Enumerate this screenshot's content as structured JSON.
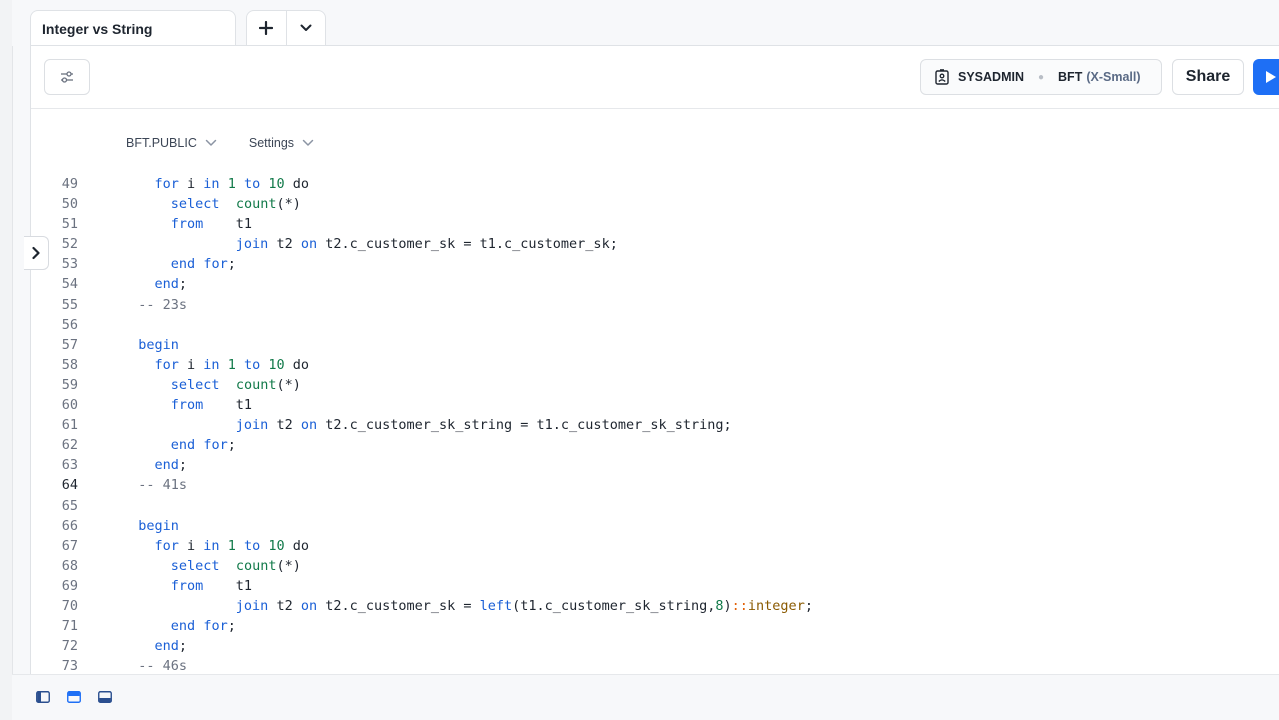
{
  "tabs": {
    "active_title": "Integer vs String"
  },
  "icons": {
    "add": "plus-icon",
    "menu": "chevron-down-icon",
    "filter": "filter-sliders-icon",
    "role": "id-badge-icon",
    "run": "play-icon",
    "rail": "chevron-right-icon"
  },
  "context": {
    "role": "SYSADMIN",
    "warehouse": "BFT",
    "warehouse_size": "(X-Small)"
  },
  "toolbar": {
    "share_label": "Share"
  },
  "db_context": {
    "database": "BFT.PUBLIC",
    "settings": "Settings"
  },
  "colors": {
    "accent": "#1e6ff5",
    "keyword": "#1a5fd6",
    "function": "#127a4a"
  },
  "code": {
    "active_line": 64,
    "lines": [
      {
        "n": 49,
        "indent": 4,
        "tokens": [
          [
            "kw",
            "for"
          ],
          [
            "t",
            " i "
          ],
          [
            "kw",
            "in"
          ],
          [
            "t",
            " "
          ],
          [
            "num",
            "1"
          ],
          [
            "t",
            " "
          ],
          [
            "kw",
            "to"
          ],
          [
            "t",
            " "
          ],
          [
            "num",
            "10"
          ],
          [
            "t",
            " do"
          ]
        ]
      },
      {
        "n": 50,
        "indent": 6,
        "tokens": [
          [
            "kw",
            "select"
          ],
          [
            "t",
            "  "
          ],
          [
            "fn",
            "count"
          ],
          [
            "t",
            "(*)"
          ]
        ]
      },
      {
        "n": 51,
        "indent": 6,
        "tokens": [
          [
            "kw",
            "from"
          ],
          [
            "t",
            "    t1"
          ]
        ]
      },
      {
        "n": 52,
        "indent": 14,
        "tokens": [
          [
            "kw",
            "join"
          ],
          [
            "t",
            " t2 "
          ],
          [
            "kw",
            "on"
          ],
          [
            "t",
            " t2.c_customer_sk = t1.c_customer_sk;"
          ]
        ]
      },
      {
        "n": 53,
        "indent": 6,
        "tokens": [
          [
            "kw",
            "end"
          ],
          [
            "t",
            " "
          ],
          [
            "kw",
            "for"
          ],
          [
            "t",
            ";"
          ]
        ]
      },
      {
        "n": 54,
        "indent": 4,
        "tokens": [
          [
            "kw",
            "end"
          ],
          [
            "t",
            ";"
          ]
        ]
      },
      {
        "n": 55,
        "indent": 2,
        "tokens": [
          [
            "cm",
            "-- 23s"
          ]
        ]
      },
      {
        "n": 56,
        "indent": 0,
        "tokens": []
      },
      {
        "n": 57,
        "indent": 2,
        "tokens": [
          [
            "kw",
            "begin"
          ]
        ]
      },
      {
        "n": 58,
        "indent": 4,
        "tokens": [
          [
            "kw",
            "for"
          ],
          [
            "t",
            " i "
          ],
          [
            "kw",
            "in"
          ],
          [
            "t",
            " "
          ],
          [
            "num",
            "1"
          ],
          [
            "t",
            " "
          ],
          [
            "kw",
            "to"
          ],
          [
            "t",
            " "
          ],
          [
            "num",
            "10"
          ],
          [
            "t",
            " do"
          ]
        ]
      },
      {
        "n": 59,
        "indent": 6,
        "tokens": [
          [
            "kw",
            "select"
          ],
          [
            "t",
            "  "
          ],
          [
            "fn",
            "count"
          ],
          [
            "t",
            "(*)"
          ]
        ]
      },
      {
        "n": 60,
        "indent": 6,
        "tokens": [
          [
            "kw",
            "from"
          ],
          [
            "t",
            "    t1"
          ]
        ]
      },
      {
        "n": 61,
        "indent": 14,
        "tokens": [
          [
            "kw",
            "join"
          ],
          [
            "t",
            " t2 "
          ],
          [
            "kw",
            "on"
          ],
          [
            "t",
            " t2.c_customer_sk_string = t1.c_customer_sk_string;"
          ]
        ]
      },
      {
        "n": 62,
        "indent": 6,
        "tokens": [
          [
            "kw",
            "end"
          ],
          [
            "t",
            " "
          ],
          [
            "kw",
            "for"
          ],
          [
            "t",
            ";"
          ]
        ]
      },
      {
        "n": 63,
        "indent": 4,
        "tokens": [
          [
            "kw",
            "end"
          ],
          [
            "t",
            ";"
          ]
        ]
      },
      {
        "n": 64,
        "indent": 2,
        "tokens": [
          [
            "cm",
            "-- 41s"
          ]
        ]
      },
      {
        "n": 65,
        "indent": 0,
        "tokens": []
      },
      {
        "n": 66,
        "indent": 2,
        "tokens": [
          [
            "kw",
            "begin"
          ]
        ]
      },
      {
        "n": 67,
        "indent": 4,
        "tokens": [
          [
            "kw",
            "for"
          ],
          [
            "t",
            " i "
          ],
          [
            "kw",
            "in"
          ],
          [
            "t",
            " "
          ],
          [
            "num",
            "1"
          ],
          [
            "t",
            " "
          ],
          [
            "kw",
            "to"
          ],
          [
            "t",
            " "
          ],
          [
            "num",
            "10"
          ],
          [
            "t",
            " do"
          ]
        ]
      },
      {
        "n": 68,
        "indent": 6,
        "tokens": [
          [
            "kw",
            "select"
          ],
          [
            "t",
            "  "
          ],
          [
            "fn",
            "count"
          ],
          [
            "t",
            "(*)"
          ]
        ]
      },
      {
        "n": 69,
        "indent": 6,
        "tokens": [
          [
            "kw",
            "from"
          ],
          [
            "t",
            "    t1"
          ]
        ]
      },
      {
        "n": 70,
        "indent": 14,
        "tokens": [
          [
            "kw",
            "join"
          ],
          [
            "t",
            " t2 "
          ],
          [
            "kw",
            "on"
          ],
          [
            "t",
            " t2.c_customer_sk = "
          ],
          [
            "kw",
            "left"
          ],
          [
            "t",
            "(t1.c_customer_sk_string,"
          ],
          [
            "num",
            "8"
          ],
          [
            "t",
            ")"
          ],
          [
            "op",
            "::"
          ],
          [
            "ty",
            "integer"
          ],
          [
            "t",
            ";"
          ]
        ]
      },
      {
        "n": 71,
        "indent": 6,
        "tokens": [
          [
            "kw",
            "end"
          ],
          [
            "t",
            " "
          ],
          [
            "kw",
            "for"
          ],
          [
            "t",
            ";"
          ]
        ]
      },
      {
        "n": 72,
        "indent": 4,
        "tokens": [
          [
            "kw",
            "end"
          ],
          [
            "t",
            ";"
          ]
        ]
      },
      {
        "n": 73,
        "indent": 2,
        "tokens": [
          [
            "cm",
            "-- 46s"
          ]
        ]
      }
    ]
  },
  "bottombar": {
    "icons": [
      "sidebar-left-icon",
      "panel-top-icon",
      "panel-bottom-icon"
    ]
  }
}
